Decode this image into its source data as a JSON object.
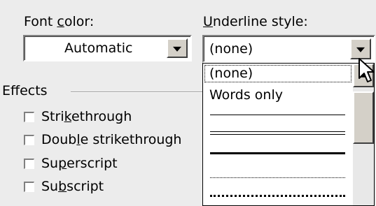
{
  "font_color": {
    "label_pre": "Font ",
    "label_key": "c",
    "label_post": "olor:",
    "value": "Automatic"
  },
  "underline_style": {
    "label_key": "U",
    "label_post": "nderline style:",
    "value": "(none)"
  },
  "effects": {
    "title": "Effects",
    "items": [
      {
        "pre": "Stri",
        "key": "k",
        "post": "ethrough",
        "checked": false
      },
      {
        "pre": "Doub",
        "key": "l",
        "post": "e strikethrough",
        "checked": false
      },
      {
        "pre": "Su",
        "key": "p",
        "post": "erscript",
        "checked": false
      },
      {
        "pre": "Su",
        "key": "b",
        "post": "script",
        "checked": false
      }
    ]
  },
  "dropdown": {
    "items": [
      {
        "label": "(none)",
        "selected": true
      },
      {
        "label": "Words only"
      }
    ],
    "line_styles": [
      "single",
      "double",
      "thick",
      "dotted",
      "thick-dotted"
    ]
  }
}
